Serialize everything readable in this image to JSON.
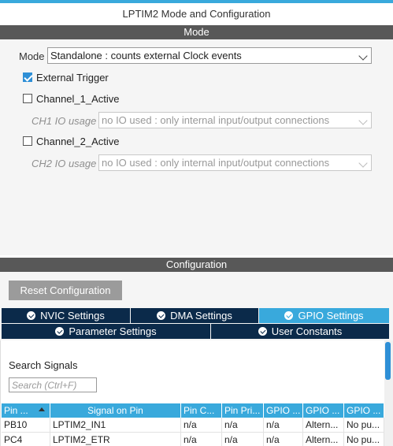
{
  "window": {
    "title": "LPTIM2 Mode and Configuration"
  },
  "mode_section": {
    "title": "Mode",
    "mode_label": "Mode",
    "mode_value": "Standalone : counts external Clock events",
    "external_trigger": {
      "label": "External Trigger",
      "checked": true
    },
    "channel1": {
      "label": "Channel_1_Active",
      "checked": false
    },
    "ch1_io": {
      "label": "CH1 IO usage",
      "value": "no IO used : only internal input/output connections"
    },
    "channel2": {
      "label": "Channel_2_Active",
      "checked": false
    },
    "ch2_io": {
      "label": "CH2 IO usage",
      "value": "no IO used : only internal input/output connections"
    }
  },
  "config_section": {
    "title": "Configuration",
    "reset_button": "Reset Configuration",
    "tabs": [
      {
        "label": "NVIC Settings",
        "active": false
      },
      {
        "label": "DMA Settings",
        "active": false
      },
      {
        "label": "GPIO Settings",
        "active": true
      },
      {
        "label": "Parameter Settings",
        "active": false
      },
      {
        "label": "User Constants",
        "active": false
      }
    ],
    "search": {
      "title": "Search Signals",
      "placeholder": "Search (Ctrl+F)"
    },
    "table": {
      "headers": [
        "Pin ...",
        "Signal on Pin",
        "Pin C...",
        "Pin Pri...",
        "GPIO ...",
        "GPIO ...",
        "GPIO ..."
      ],
      "rows": [
        [
          "PB10",
          "LPTIM2_IN1",
          "n/a",
          "n/a",
          "n/a",
          "Altern...",
          "No pu..."
        ],
        [
          "PC4",
          "LPTIM2_ETR",
          "n/a",
          "n/a",
          "n/a",
          "Altern...",
          "No pu..."
        ]
      ]
    }
  },
  "colors": {
    "accent": "#39a9dc",
    "section_bar": "#585858",
    "tab_dark": "#0b2a4a",
    "button_grey": "#9b9b9b"
  }
}
